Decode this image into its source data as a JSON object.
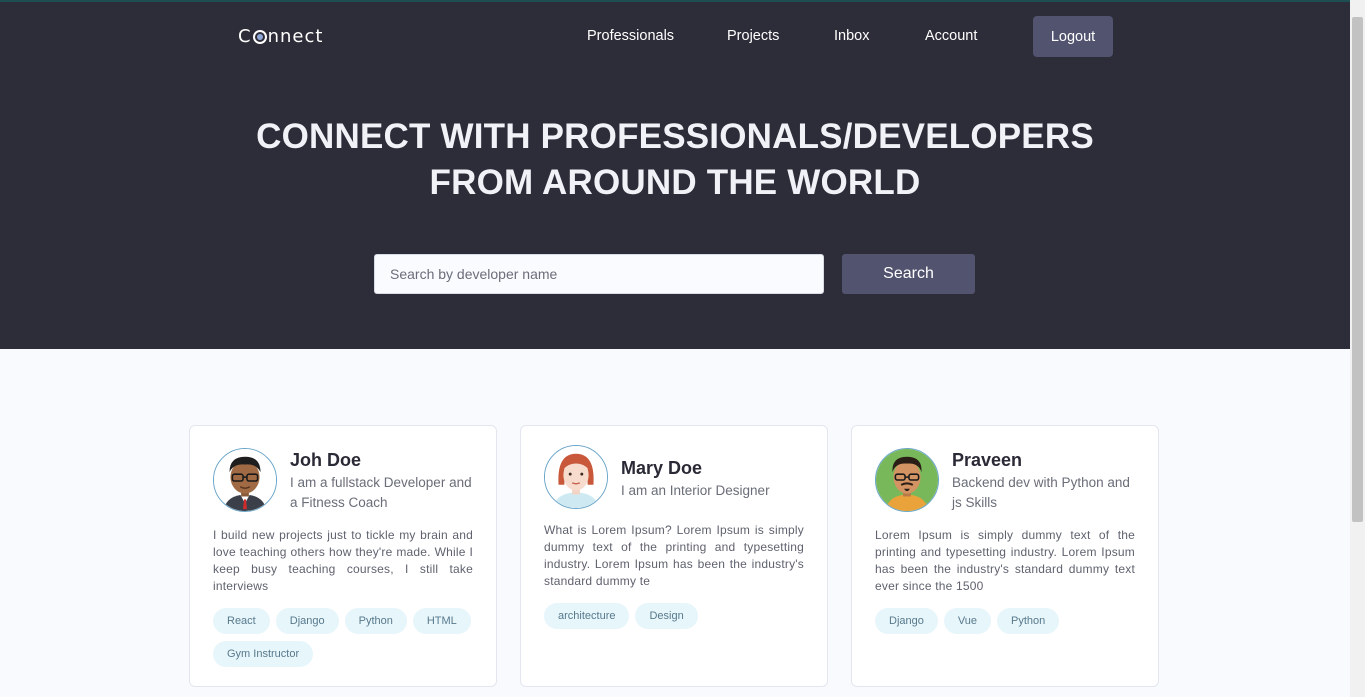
{
  "brand": {
    "before": "C",
    "after": "nnect"
  },
  "nav": {
    "items": [
      "Professionals",
      "Projects",
      "Inbox",
      "Account"
    ],
    "logout_label": "Logout"
  },
  "hero": {
    "line1_normal": "CONNECT WITH ",
    "line1_bold": "PROFESSIONALS/DEVELOPERS",
    "line2": "FROM AROUND THE WORLD"
  },
  "search": {
    "placeholder": "Search by developer name",
    "value": "",
    "button_label": "Search"
  },
  "cards": [
    {
      "name": "Joh Doe",
      "title": "I am a fullstack Developer and a Fitness Coach",
      "bio": "I build new projects just to tickle my brain and love teaching others how they're made. While I keep busy teaching courses, I still take interviews",
      "tags": [
        "React",
        "Django",
        "Python",
        "HTML",
        "Gym Instructor"
      ]
    },
    {
      "name": "Mary Doe",
      "title": "I am an Interior Designer",
      "bio": "What is Lorem Ipsum? Lorem Ipsum is simply dummy text of the printing and typesetting industry. Lorem Ipsum has been the industry's standard dummy te",
      "tags": [
        "architecture",
        "Design"
      ]
    },
    {
      "name": "Praveen",
      "title": "Backend dev with Python and js Skills",
      "bio": "Lorem Ipsum is simply dummy text of the printing and typesetting industry. Lorem Ipsum has been the industry's standard dummy text ever since the 1500",
      "tags": [
        "Django",
        "Vue",
        "Python"
      ]
    }
  ],
  "icons": {
    "search": "magnifier-icon"
  },
  "colors": {
    "hero_bg": "#2d2d39",
    "accent_button": "#52536e",
    "tag_bg": "#e7f6fb",
    "page_bg": "#f8fafd"
  }
}
